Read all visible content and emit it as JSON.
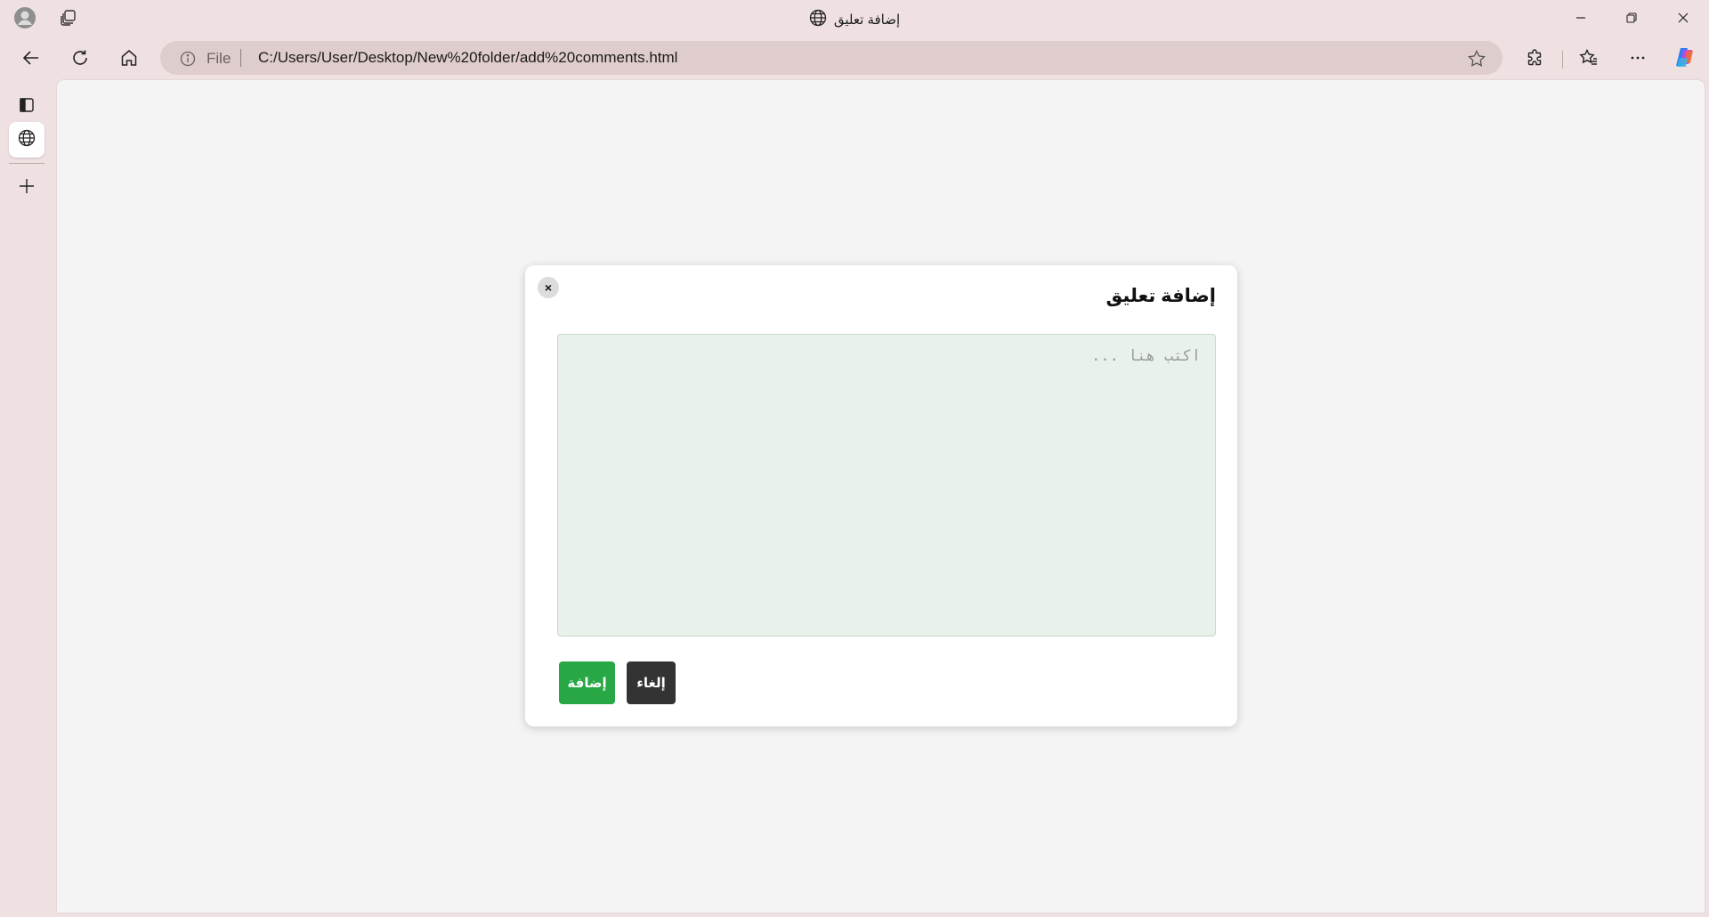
{
  "window": {
    "title": "إضافة تعليق",
    "controls": [
      "minimize",
      "restore",
      "close"
    ]
  },
  "navbar": {
    "address_scheme": "File",
    "address_url": "C:/Users/User/Desktop/New%20folder/add%20comments.html"
  },
  "sidebar": {
    "items": [
      "vertical-tabs-icon",
      "globe-icon",
      "new-tab-icon"
    ]
  },
  "modal": {
    "title": "إضافة تعليق",
    "close_label": "×",
    "placeholder": "اكتب هنا ...",
    "value": "",
    "add_label": "إضافة",
    "cancel_label": "إلغاء"
  },
  "colors": {
    "accent_green": "#28a745",
    "cancel_dark": "#333333",
    "textarea_bg": "#e8f2ea",
    "chrome_bg": "#efe1e1"
  }
}
